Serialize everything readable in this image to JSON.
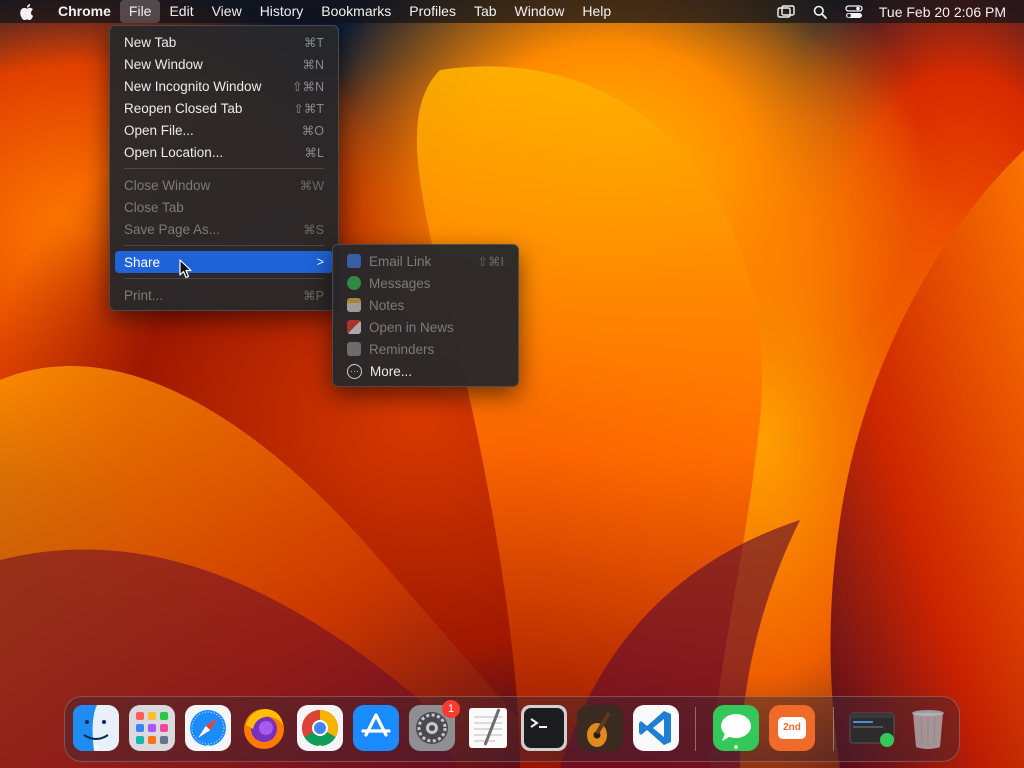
{
  "menubar": {
    "app_name": "Chrome",
    "menus": [
      "File",
      "Edit",
      "View",
      "History",
      "Bookmarks",
      "Profiles",
      "Tab",
      "Window",
      "Help"
    ],
    "active_menu": "File",
    "clock": "Tue Feb 20  2:06 PM",
    "status_icons": [
      "screen-mirroring-icon",
      "search-icon",
      "control-center-icon"
    ]
  },
  "file_menu": {
    "items": [
      {
        "label": "New Tab",
        "shortcut": "⌘T",
        "enabled": true
      },
      {
        "label": "New Window",
        "shortcut": "⌘N",
        "enabled": true
      },
      {
        "label": "New Incognito Window",
        "shortcut": "⇧⌘N",
        "enabled": true
      },
      {
        "label": "Reopen Closed Tab",
        "shortcut": "⇧⌘T",
        "enabled": true
      },
      {
        "label": "Open File...",
        "shortcut": "⌘O",
        "enabled": true
      },
      {
        "label": "Open Location...",
        "shortcut": "⌘L",
        "enabled": true
      },
      {
        "label": "Close Window",
        "shortcut": "⌘W",
        "enabled": false
      },
      {
        "label": "Close Tab",
        "shortcut": "",
        "enabled": false
      },
      {
        "label": "Save Page As...",
        "shortcut": "⌘S",
        "enabled": false
      },
      {
        "label": "Share",
        "shortcut": ">",
        "enabled": true,
        "highlighted": true
      },
      {
        "label": "Print...",
        "shortcut": "⌘P",
        "enabled": false
      }
    ]
  },
  "share_menu": {
    "items": [
      {
        "label": "Email Link",
        "shortcut": "⇧⌘I",
        "enabled": false,
        "icon": "mail-icon",
        "color": "#3b82f6"
      },
      {
        "label": "Messages",
        "shortcut": "",
        "enabled": false,
        "icon": "messages-icon",
        "color": "#34c759"
      },
      {
        "label": "Notes",
        "shortcut": "",
        "enabled": false,
        "icon": "notes-icon",
        "color": "#f5c542"
      },
      {
        "label": "Open in News",
        "shortcut": "",
        "enabled": false,
        "icon": "news-icon",
        "color": "#ff3b30"
      },
      {
        "label": "Reminders",
        "shortcut": "",
        "enabled": false,
        "icon": "reminders-icon",
        "color": "#9a9a9a"
      },
      {
        "label": "More...",
        "shortcut": "",
        "enabled": true,
        "icon": "more-icon",
        "color": "#cfcfcf"
      }
    ]
  },
  "dock": {
    "apps": [
      {
        "name": "Finder",
        "icon": "finder-icon",
        "running": true
      },
      {
        "name": "Launchpad",
        "icon": "launchpad-icon",
        "running": false
      },
      {
        "name": "Safari",
        "icon": "safari-icon",
        "running": true
      },
      {
        "name": "Firefox",
        "icon": "firefox-icon",
        "running": false
      },
      {
        "name": "Chrome",
        "icon": "chrome-icon",
        "running": true
      },
      {
        "name": "App Store",
        "icon": "app-store-icon",
        "running": false
      },
      {
        "name": "System Settings",
        "icon": "system-settings-icon",
        "running": false,
        "badge": "1"
      },
      {
        "name": "TextEdit",
        "icon": "textedit-icon",
        "running": false
      },
      {
        "name": "Terminal",
        "icon": "terminal-icon",
        "running": false
      },
      {
        "name": "GarageBand",
        "icon": "garageband-icon",
        "running": false
      },
      {
        "name": "VS Code",
        "icon": "vscode-icon",
        "running": false
      },
      {
        "name": "Messages",
        "icon": "messages-icon",
        "running": true
      },
      {
        "name": "2nd",
        "icon": "second-icon",
        "running": false,
        "text": "2nd"
      },
      {
        "name": "Window Preview",
        "icon": "window-preview-icon",
        "running": false
      },
      {
        "name": "Trash",
        "icon": "trash-icon",
        "running": false
      }
    ]
  }
}
